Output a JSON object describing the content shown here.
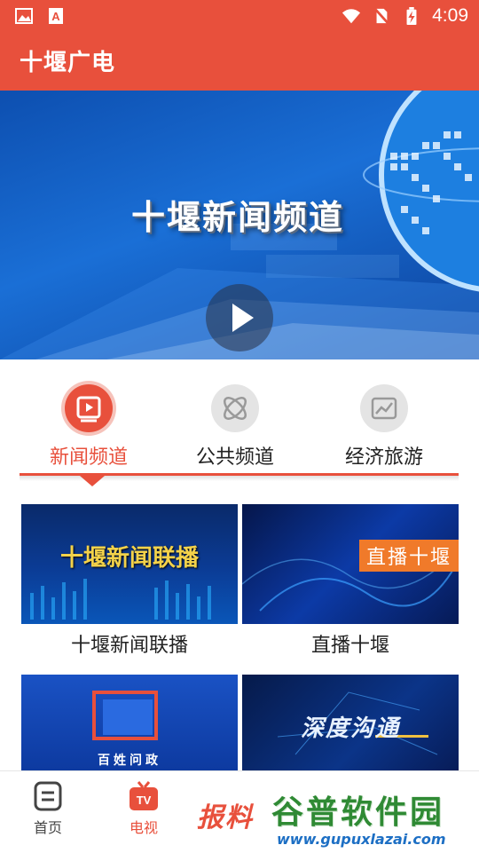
{
  "status_bar": {
    "time": "4:09",
    "icons": [
      "image-icon",
      "text-a-icon",
      "wifi-icon",
      "no-sim-icon",
      "battery-charging-icon"
    ]
  },
  "app_bar": {
    "title": "十堰广电"
  },
  "hero": {
    "title": "十堰新闻频道",
    "play_icon": "play-icon"
  },
  "tabs": [
    {
      "label": "新闻频道",
      "icon": "tv-icon",
      "active": true
    },
    {
      "label": "公共频道",
      "icon": "atom-icon",
      "active": false
    },
    {
      "label": "经济旅游",
      "icon": "chart-icon",
      "active": false
    }
  ],
  "programs": [
    {
      "label": "十堰新闻联播",
      "thumb_text": "十堰新闻联播"
    },
    {
      "label": "直播十堰",
      "thumb_text": "直播十堰"
    },
    {
      "label": "",
      "thumb_text": "百姓问政"
    },
    {
      "label": "",
      "thumb_text": "深度沟通"
    }
  ],
  "bottom_nav": [
    {
      "label": "首页",
      "icon": "document-icon",
      "active": false
    },
    {
      "label": "电视",
      "icon": "tv-icon",
      "active": true
    }
  ],
  "report_button": {
    "label": "报料"
  },
  "watermark": {
    "title": "谷普软件园",
    "url": "www.gupuxlazai.com"
  },
  "colors": {
    "accent": "#e8503c",
    "tab_inactive_icon_bg": "#e4e4e4"
  }
}
